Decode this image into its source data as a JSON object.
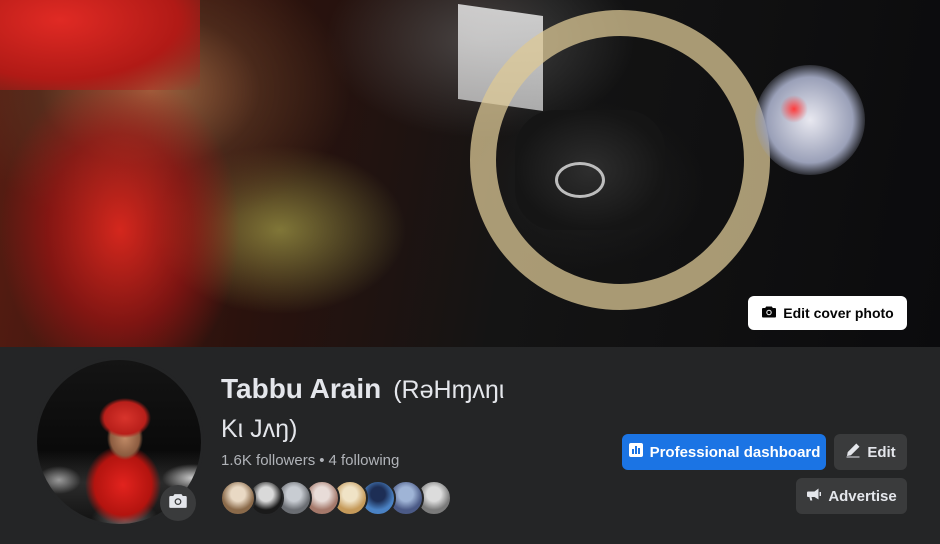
{
  "cover": {
    "edit_label": "Edit cover photo",
    "camera_icon": "camera-icon"
  },
  "profile": {
    "name": "Tabbu Arain",
    "alternate_name_line1": "(RəHɱʌŋι",
    "alternate_name_line2": "Kι Jʌŋ)",
    "followers": "1.6K followers",
    "separator": "•",
    "following": "4 following",
    "avatar_camera_icon": "camera-icon"
  },
  "friends": {
    "avatars": [
      {
        "color_a": "#8a6a4a",
        "color_b": "#e9d9c4"
      },
      {
        "color_a": "#1a1a1a",
        "color_b": "#d9d9d9"
      },
      {
        "color_a": "#6a6d72",
        "color_b": "#c8ccd2"
      },
      {
        "color_a": "#a4786a",
        "color_b": "#e8dcd8"
      },
      {
        "color_a": "#c59a5a",
        "color_b": "#f0e3c6"
      },
      {
        "color_a": "#4a82c4",
        "color_b": "#1d2e55"
      },
      {
        "color_a": "#4b5a86",
        "color_b": "#9fb4d6"
      },
      {
        "color_a": "#7a7a7a",
        "color_b": "#dcdcdc"
      }
    ]
  },
  "actions": {
    "professional_dashboard": "Professional dashboard",
    "edit": "Edit",
    "advertise": "Advertise",
    "dashboard_icon": "bar-chart-icon",
    "edit_icon": "pencil-icon",
    "advertise_icon": "megaphone-icon"
  },
  "colors": {
    "page_bg": "#242526",
    "primary_button": "#1b74e4",
    "secondary_button": "#3a3b3c",
    "text_primary": "#e4e6eb",
    "text_secondary": "#b0b3b8"
  }
}
